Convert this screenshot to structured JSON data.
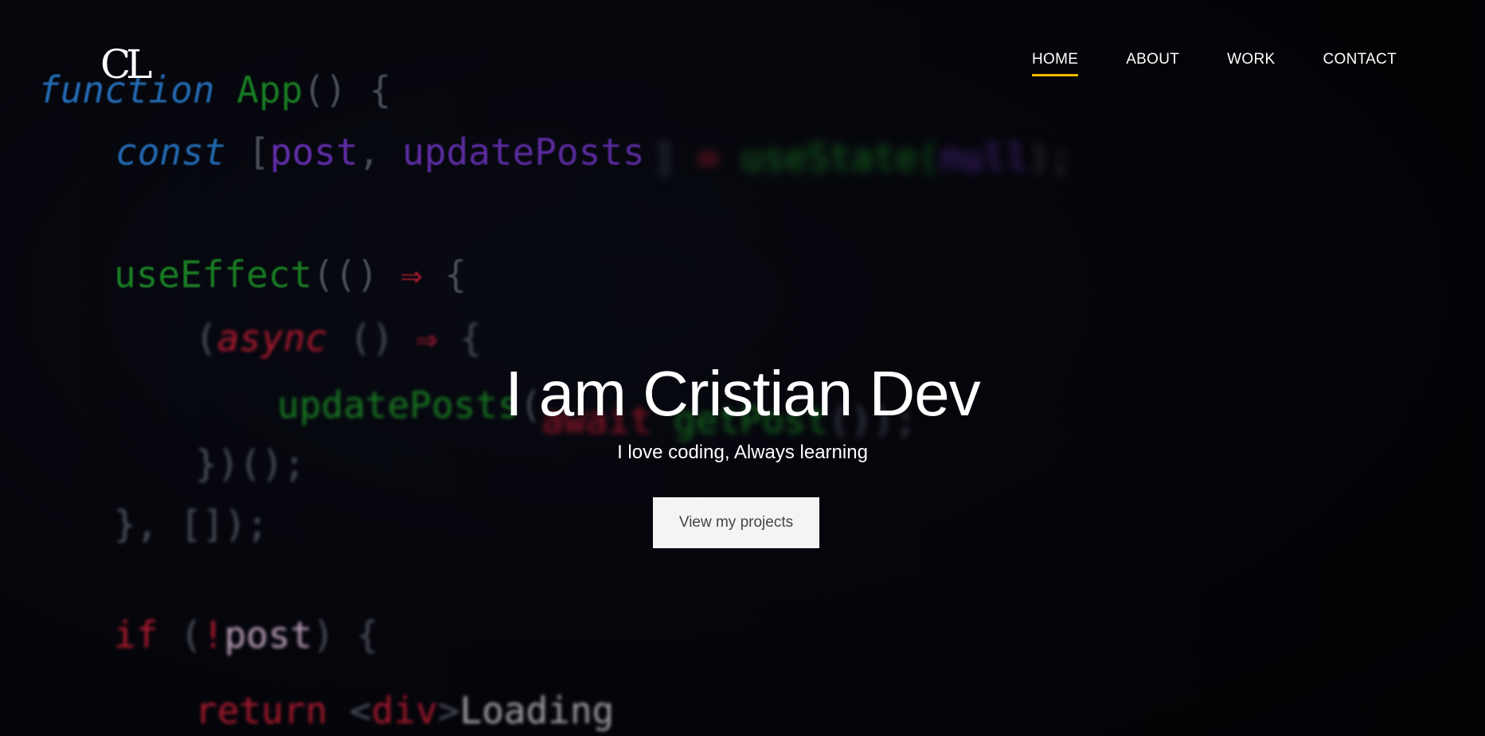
{
  "logo": {
    "text": "CL"
  },
  "nav": {
    "items": [
      {
        "label": "HOME",
        "active": true
      },
      {
        "label": "ABOUT",
        "active": false
      },
      {
        "label": "WORK",
        "active": false
      },
      {
        "label": "CONTACT",
        "active": false
      }
    ],
    "active_underline_color": "#f5b800"
  },
  "hero": {
    "title": "I am Cristian Dev",
    "subtitle": "I love coding, Always learning",
    "button_label": "View my projects"
  },
  "background_code": [
    "function App() {",
    "const [post, updatePosts] = useState(null);",
    "useEffect(() => {",
    "(async () => {",
    "updatePosts(",
    "})();",
    "}, []);",
    "if (!post) {",
    "return <div>Loading"
  ]
}
